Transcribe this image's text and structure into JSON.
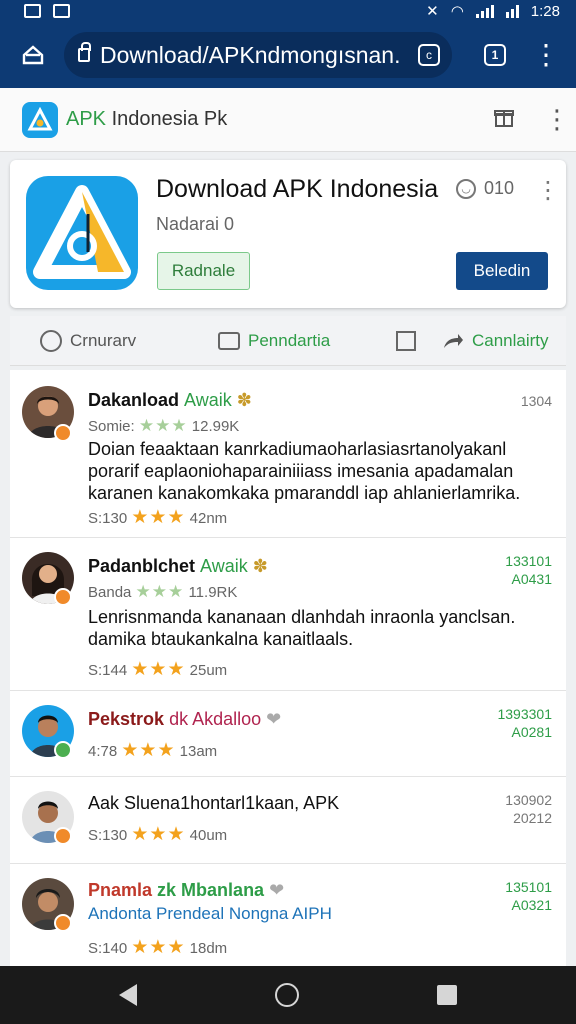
{
  "status": {
    "time": "1:28"
  },
  "browser": {
    "url": "Download/APKndmongısnan.",
    "url_badge": "c",
    "tabs_count": "1"
  },
  "site": {
    "name_prefix": "APK",
    "name_suffix": " Indonesia Pk"
  },
  "app": {
    "title": "Download APK Indonesia",
    "rating": "010",
    "subtitle": "Nadarai 0",
    "btn_primary": "Radnale",
    "btn_secondary": "Beledin"
  },
  "tabs": [
    "Crnurarv",
    "Penndartia",
    "Cannlairty"
  ],
  "posts": [
    {
      "name": "Dakanload",
      "tag": "Awaik",
      "meta_label": "Somie:",
      "meta_value": "12.99K",
      "side": [
        "1304"
      ],
      "body": "Doian feaaktaan kanrkadiumaoharlasiasrtanolyakanl porarif eaplaoniohaparainiiiass imesania apadamalan karanen kanakomkaka pmaranddl iap ahlanierlamrika.",
      "foot_label": "S:130",
      "foot_value": "42nm"
    },
    {
      "name": "Padanblchet",
      "tag": "Awaik",
      "meta_label": "Banda",
      "meta_value": "11.9RK",
      "side": [
        "133101",
        "A0431"
      ],
      "body": "Lenrisnmanda kananaan dlanhdah inraonla yanclsan. damika btaukankalna kanaitlaals.",
      "foot_label": "S:144",
      "foot_value": "25um"
    },
    {
      "name": "Pekstrok",
      "tag": "dk Akdalloo",
      "side": [
        "1393301",
        "A0281"
      ],
      "foot_label": "4:78",
      "foot_value": "13am"
    },
    {
      "name": "Aak Sluena1hontarl1kaan, APK",
      "side": [
        "130902",
        "20212"
      ],
      "foot_label": "S:130",
      "foot_value": "40um"
    },
    {
      "name": "Pnamla",
      "tag": "zk Mbanlana",
      "sub": "Andonta Prendeal Nongna AIPH",
      "side": [
        "135101",
        "A0321"
      ],
      "foot_label": "S:140",
      "foot_value": "18dm"
    }
  ],
  "colors": {
    "brand_blue": "#0d3a74",
    "accent_green": "#2e9d48",
    "star": "#f3a21d"
  }
}
